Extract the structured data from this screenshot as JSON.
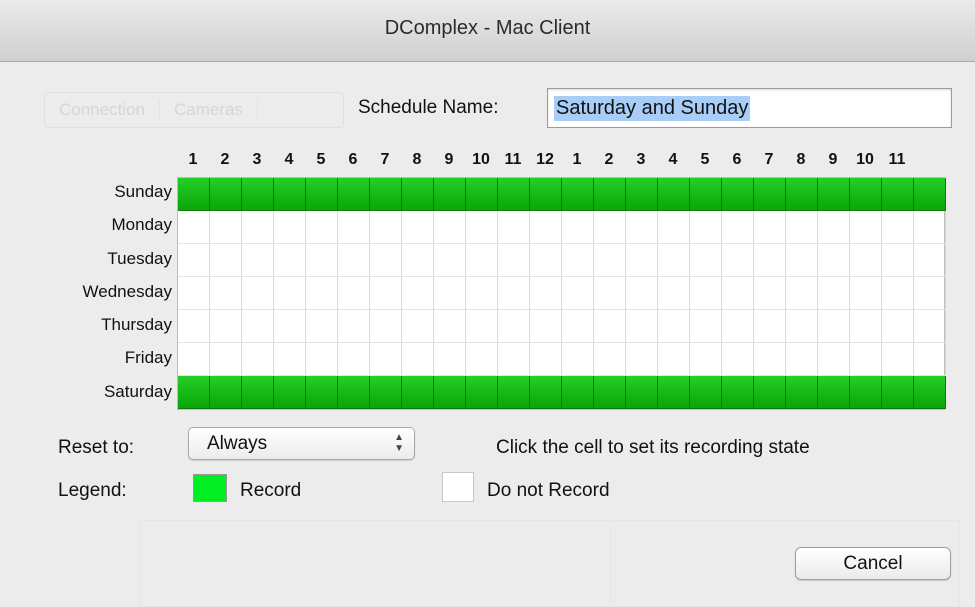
{
  "window": {
    "title": "DComplex - Mac Client"
  },
  "background_tabs": [
    "Connection",
    "Cameras"
  ],
  "schedule": {
    "label": "Schedule Name:",
    "value": "Saturday and Sunday"
  },
  "hours": [
    "1",
    "2",
    "3",
    "4",
    "5",
    "6",
    "7",
    "8",
    "9",
    "10",
    "11",
    "12",
    "1",
    "2",
    "3",
    "4",
    "5",
    "6",
    "7",
    "8",
    "9",
    "10",
    "11"
  ],
  "days": [
    {
      "name": "Sunday",
      "record": [
        true,
        true,
        true,
        true,
        true,
        true,
        true,
        true,
        true,
        true,
        true,
        true,
        true,
        true,
        true,
        true,
        true,
        true,
        true,
        true,
        true,
        true,
        true,
        true
      ]
    },
    {
      "name": "Monday",
      "record": [
        false,
        false,
        false,
        false,
        false,
        false,
        false,
        false,
        false,
        false,
        false,
        false,
        false,
        false,
        false,
        false,
        false,
        false,
        false,
        false,
        false,
        false,
        false,
        false
      ]
    },
    {
      "name": "Tuesday",
      "record": [
        false,
        false,
        false,
        false,
        false,
        false,
        false,
        false,
        false,
        false,
        false,
        false,
        false,
        false,
        false,
        false,
        false,
        false,
        false,
        false,
        false,
        false,
        false,
        false
      ]
    },
    {
      "name": "Wednesday",
      "record": [
        false,
        false,
        false,
        false,
        false,
        false,
        false,
        false,
        false,
        false,
        false,
        false,
        false,
        false,
        false,
        false,
        false,
        false,
        false,
        false,
        false,
        false,
        false,
        false
      ]
    },
    {
      "name": "Thursday",
      "record": [
        false,
        false,
        false,
        false,
        false,
        false,
        false,
        false,
        false,
        false,
        false,
        false,
        false,
        false,
        false,
        false,
        false,
        false,
        false,
        false,
        false,
        false,
        false,
        false
      ]
    },
    {
      "name": "Friday",
      "record": [
        false,
        false,
        false,
        false,
        false,
        false,
        false,
        false,
        false,
        false,
        false,
        false,
        false,
        false,
        false,
        false,
        false,
        false,
        false,
        false,
        false,
        false,
        false,
        false
      ]
    },
    {
      "name": "Saturday",
      "record": [
        true,
        true,
        true,
        true,
        true,
        true,
        true,
        true,
        true,
        true,
        true,
        true,
        true,
        true,
        true,
        true,
        true,
        true,
        true,
        true,
        true,
        true,
        true,
        true
      ]
    }
  ],
  "reset": {
    "label": "Reset to:",
    "value": "Always"
  },
  "hint": "Click the cell to set its recording state",
  "legend": {
    "label": "Legend:",
    "record": "Record",
    "no_record": "Do not Record",
    "record_color": "#00ee22",
    "no_record_color": "#ffffff"
  },
  "cancel_label": "Cancel"
}
